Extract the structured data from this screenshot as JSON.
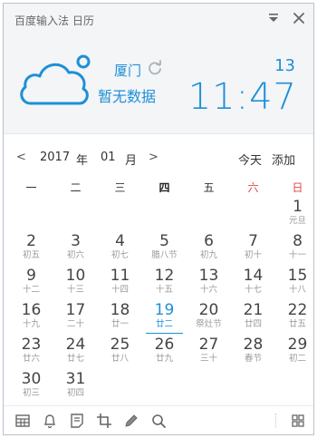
{
  "app": {
    "title": "百度输入法 日历"
  },
  "weather": {
    "icon": "cloud-icon",
    "city": "厦门",
    "status": "暂无数据"
  },
  "clock": {
    "day": "13",
    "time": "11:47"
  },
  "nav": {
    "prev": "<",
    "year": "2017",
    "year_unit": "年",
    "month": "01",
    "month_unit": "月",
    "next": ">",
    "today": "今天",
    "add": "添加"
  },
  "weekdays": [
    "一",
    "二",
    "三",
    "四",
    "五",
    "六",
    "日"
  ],
  "colors": {
    "accent": "#1e8fd8",
    "weekend": "#e24444"
  },
  "days": [
    {
      "d": "1",
      "s": "元旦"
    },
    {
      "d": "2",
      "s": "初五"
    },
    {
      "d": "3",
      "s": "初六"
    },
    {
      "d": "4",
      "s": "初七"
    },
    {
      "d": "5",
      "s": "腊八节"
    },
    {
      "d": "6",
      "s": "初九"
    },
    {
      "d": "7",
      "s": "初十"
    },
    {
      "d": "8",
      "s": "十一"
    },
    {
      "d": "9",
      "s": "十二"
    },
    {
      "d": "10",
      "s": "十三"
    },
    {
      "d": "11",
      "s": "十四"
    },
    {
      "d": "12",
      "s": "十五"
    },
    {
      "d": "13",
      "s": "十六"
    },
    {
      "d": "14",
      "s": "十七"
    },
    {
      "d": "15",
      "s": "十八"
    },
    {
      "d": "16",
      "s": "十九"
    },
    {
      "d": "17",
      "s": "二十"
    },
    {
      "d": "18",
      "s": "廿一"
    },
    {
      "d": "19",
      "s": "廿二"
    },
    {
      "d": "20",
      "s": "祭灶节"
    },
    {
      "d": "21",
      "s": "廿四"
    },
    {
      "d": "22",
      "s": "廿五"
    },
    {
      "d": "23",
      "s": "廿六"
    },
    {
      "d": "24",
      "s": "廿七"
    },
    {
      "d": "25",
      "s": "廿八"
    },
    {
      "d": "26",
      "s": "廿九"
    },
    {
      "d": "27",
      "s": "三十"
    },
    {
      "d": "28",
      "s": "春节"
    },
    {
      "d": "29",
      "s": "初二"
    },
    {
      "d": "30",
      "s": "初三"
    },
    {
      "d": "31",
      "s": "初四"
    }
  ],
  "selected_day": "19",
  "toolbar": [
    "calendar-grid-icon",
    "bell-icon",
    "note-icon",
    "crop-icon",
    "pen-icon",
    "search-icon",
    "apps-icon"
  ]
}
